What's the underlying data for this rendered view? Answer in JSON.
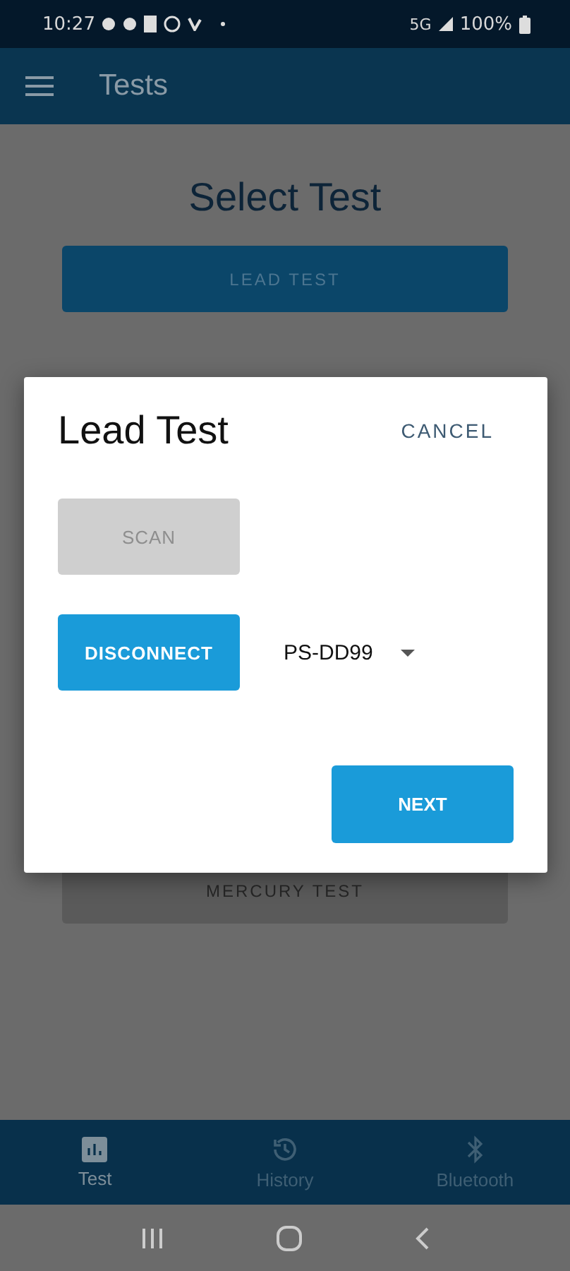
{
  "status_bar": {
    "time": "10:27",
    "network": "5G",
    "battery": "100%"
  },
  "app_bar": {
    "title": "Tests"
  },
  "heading": "Select Test",
  "tests": [
    {
      "label": "LEAD TEST"
    },
    {
      "label": "MERCURY TEST"
    }
  ],
  "dialog": {
    "title": "Lead Test",
    "cancel": "CANCEL",
    "buttons": [
      {
        "label": "SCAN",
        "disabled": true
      },
      {
        "label": "DISCONNECT",
        "disabled": false
      }
    ],
    "device_select": {
      "value": "PS-DD99"
    },
    "next": "NEXT"
  },
  "bottom_nav": [
    {
      "label": "Test",
      "kind": "chart",
      "selected": true
    },
    {
      "label": "History",
      "kind": "history",
      "selected": false
    },
    {
      "label": "Bluetooth",
      "kind": "bluetooth",
      "selected": false
    }
  ]
}
